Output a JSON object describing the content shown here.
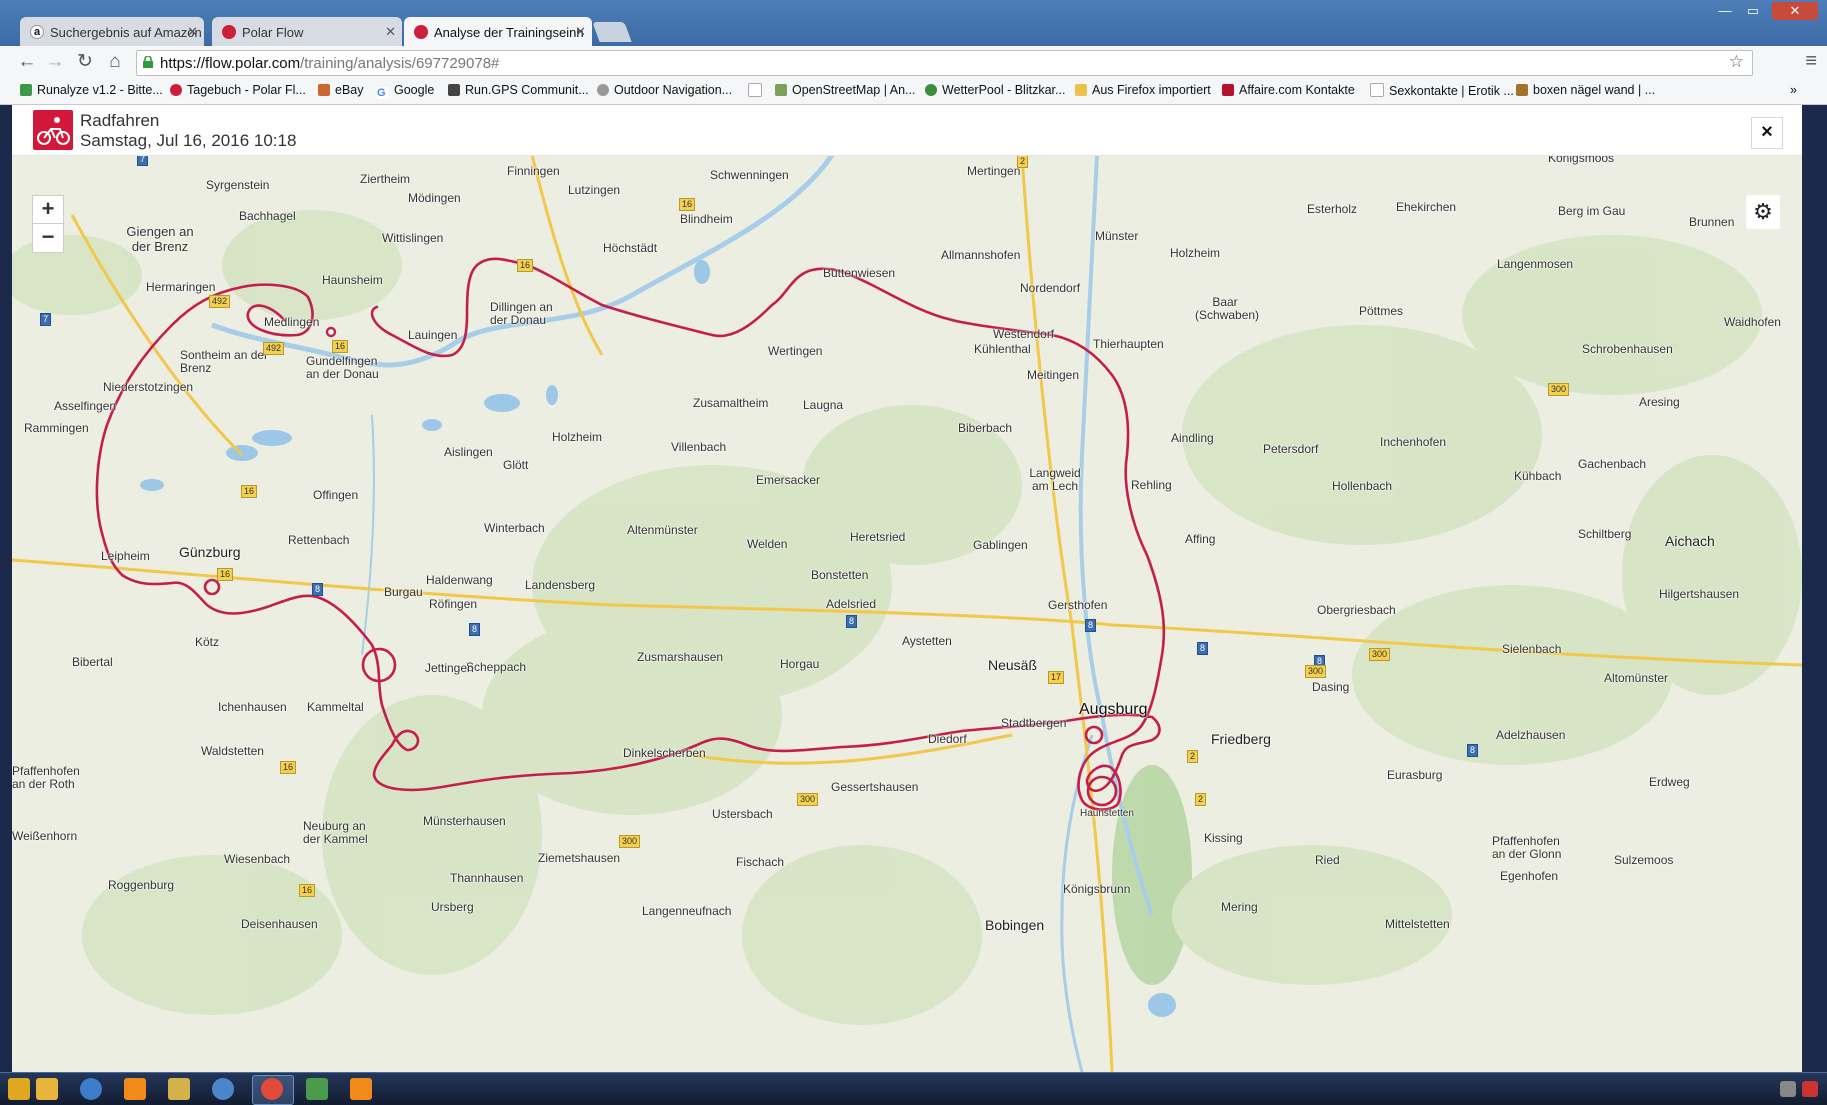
{
  "browser": {
    "tabs": [
      {
        "title": "Suchergebnis auf Amazon",
        "active": false
      },
      {
        "title": "Polar Flow",
        "active": false
      },
      {
        "title": "Analyse der Trainingseinh",
        "active": true
      }
    ],
    "url_host": "https://flow.polar.com",
    "url_path": "/training/analysis/697729078#",
    "bookmarks": [
      "Runalyze v1.2 - Bitte...",
      "Tagebuch - Polar Fl...",
      "eBay",
      "Google",
      "Run.GPS Communit...",
      "Outdoor Navigation...",
      "",
      "OpenStreetMap | An...",
      "WetterPool - Blitzkar...",
      "Aus Firefox importiert",
      "Affaire.com Kontakte",
      "Sexkontakte | Erotik ...",
      "boxen nägel wand | ..."
    ],
    "bookmarks_more": "»"
  },
  "session": {
    "sport": "Radfahren",
    "datetime": "Samstag, Jul 16, 2016 10:18",
    "close": "×"
  },
  "map": {
    "zoom_in": "+",
    "zoom_out": "−",
    "layers_icon": "gear-icon",
    "route_color": "#c41e4a",
    "places": [
      "Königsmoos",
      "Mertingen",
      "Schwenningen",
      "Finningen",
      "Ziertheim",
      "Syrgenstein",
      "Mödingen",
      "Lutzingen",
      "Blindheim",
      "Esterholz",
      "Ehekirchen",
      "Berg im Gau",
      "Brunnen",
      "Bachhagel",
      "Giengen an der Brenz",
      "Wittislingen",
      "Höchstädt",
      "Allmannshofen",
      "Münster",
      "Holzheim",
      "Langenmosen",
      "Haunsheim",
      "Buttenwiesen",
      "Nordendorf",
      "Hermaringen",
      "Medlingen",
      "Dillingen an der Donau",
      "Lauingen",
      "Baar (Schwaben)",
      "Pöttmes",
      "Waidhofen",
      "Sontheim an der Brenz",
      "Gundelfingen an der Donau",
      "Wertingen",
      "Westendorf",
      "Kühlenthal",
      "Thierhaupten",
      "Schrobenhausen",
      "Niederstotzingen",
      "Meitingen",
      "Asselfingen",
      "Zusamaltheim",
      "Laugna",
      "Rammingen",
      "Biberbach",
      "Aindling",
      "Inchenhofen",
      "Aresing",
      "Holzheim",
      "Aislingen",
      "Glött",
      "Villenbach",
      "Petersdorf",
      "Gachenbach",
      "Langweid am Lech",
      "Hollenbach",
      "Kühbach",
      "Offingen",
      "Emersacker",
      "Rehling",
      "Winterbach",
      "Altenmünster",
      "Affing",
      "Aichach",
      "Schiltberg",
      "Günzburg",
      "Leipheim",
      "Rettenbach",
      "Welden",
      "Heretsried",
      "Gablingen",
      "Haldenwang",
      "Bonstetten",
      "Burgau",
      "Landensberg",
      "Adelsried",
      "Gersthofen",
      "Obergriesbach",
      "Hilgertshausen",
      "Röfingen",
      "Aystetten",
      "Kötz",
      "Zusmarshausen",
      "Horgau",
      "Neusäß",
      "Sielenbach",
      "Bibertal",
      "Scheppach",
      "Dasing",
      "Altomünster",
      "Augsburg",
      "Ichenhausen",
      "Kammeltal",
      "Stadtbergen",
      "Diedorf",
      "Friedberg",
      "Adelzhausen",
      "Waldstetten",
      "Dinkelscherben",
      "Jettingen",
      "Eurasburg",
      "Erdweg",
      "Gessertshausen",
      "Münsterhausen",
      "Ustersbach",
      "Kissing",
      "Pfaffenhofen an der Glonn",
      "Ziemetshausen",
      "Fischach",
      "Ried",
      "Sulzemoos",
      "Wiesenbach",
      "Thannhausen",
      "Egenhofen",
      "Roggenburg",
      "Langenneufnach",
      "Bobingen",
      "Königsbrunn",
      "Mering",
      "Ursberg",
      "Mittelstetten",
      "Deisenhausen",
      "Neuburg an der Kammel",
      "Pfaffenhofen an der Roth",
      "Weißenhorn",
      "Haunstetten"
    ],
    "roads": [
      "7",
      "2",
      "16",
      "492",
      "16",
      "16",
      "7",
      "492",
      "16",
      "16",
      "8",
      "8",
      "8",
      "8",
      "17",
      "8",
      "300",
      "8",
      "300",
      "2",
      "2",
      "300",
      "8",
      "300",
      "16",
      "300",
      "16"
    ]
  }
}
